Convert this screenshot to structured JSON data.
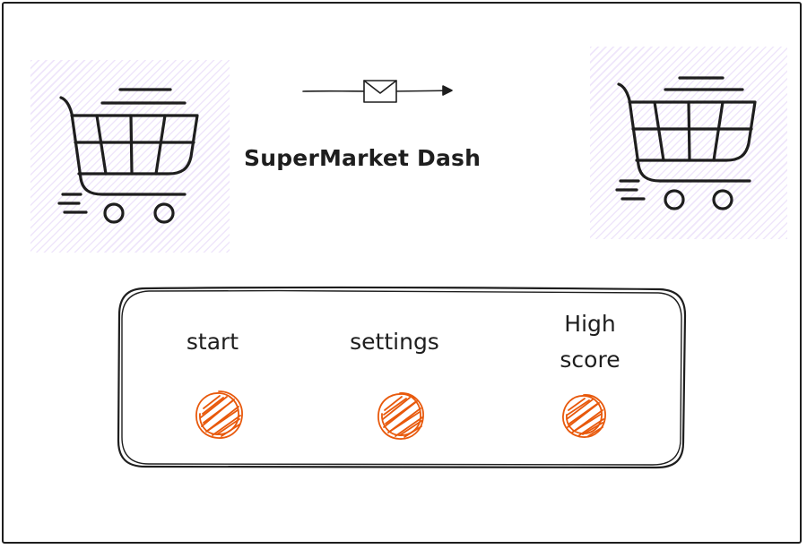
{
  "game": {
    "title": "SuperMarket Dash"
  },
  "menu": {
    "start_label": "start",
    "settings_label": "settings",
    "highscore_label": "High\nscore"
  },
  "colors": {
    "ink": "#1e1e1e",
    "tile_hatch": "#e3d5f7",
    "button_fill": "#e8590c"
  },
  "icons": {
    "left_tile": "shopping-cart-icon",
    "right_tile": "shopping-cart-icon",
    "header": "envelope-arrow-icon",
    "buttons": "scribble-circle-icon"
  }
}
